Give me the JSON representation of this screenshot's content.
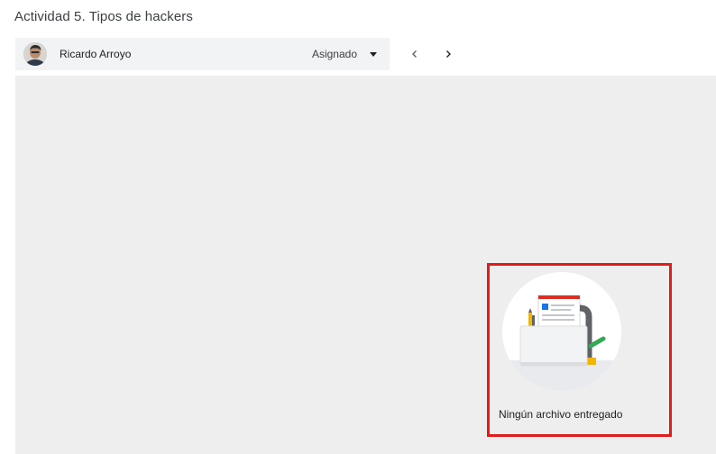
{
  "assignment": {
    "title": "Actividad 5. Tipos de hackers"
  },
  "student": {
    "name": "Ricardo Arroyo",
    "status": "Asignado"
  },
  "navigation": {
    "prev_icon": "chevron-left-icon",
    "next_icon": "chevron-right-icon"
  },
  "viewer": {
    "empty_message": "Ningún archivo entregado"
  },
  "colors": {
    "highlight": "#e21b1b",
    "viewer_background": "#eeeeee",
    "bar_background": "#f1f3f4"
  }
}
